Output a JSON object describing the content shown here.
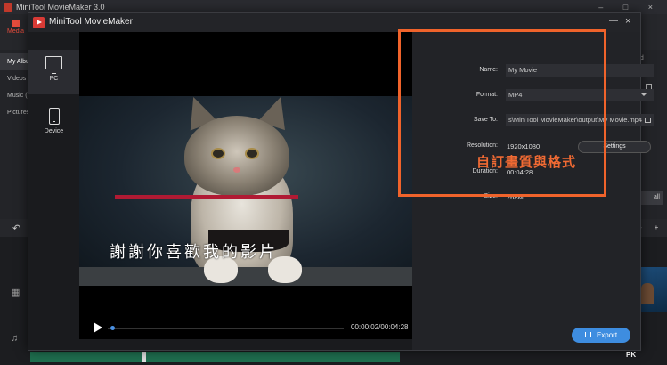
{
  "app": {
    "title": "MiniTool MovieMaker 3.0",
    "window_controls": "–  □  ×",
    "media_tab": "Media",
    "sidebar_items": [
      "My Album",
      "Videos",
      "Music (",
      "Pictures"
    ],
    "right_label": "ed",
    "all_button": "all",
    "undo_icon": "undo-icon",
    "zoom_controls": "–  +"
  },
  "dialog": {
    "title": "MiniTool MovieMaker",
    "minimize": "—",
    "close": "×",
    "devices": [
      {
        "label": "PC",
        "icon": "monitor-icon",
        "selected": true
      },
      {
        "label": "Device",
        "icon": "phone-icon",
        "selected": false
      }
    ],
    "subtitle_text": "謝謝你喜歡我的影片",
    "time": "00:00:02/00:04:28",
    "progress": 0.01,
    "fields": {
      "name_label": "Name:",
      "name_value": "My Movie",
      "format_label": "Format:",
      "format_value": "MP4",
      "save_label": "Save To:",
      "save_value": "s\\MiniTool MovieMaker\\output\\My Movie.mp4",
      "resolution_label": "Resolution:",
      "resolution_value": "1920x1080",
      "settings_button": "Settings",
      "duration_label": "Duration:",
      "duration_value": "00:04:28",
      "size_label": "Size:",
      "size_value": "268M"
    },
    "callout": "自訂畫質與格式",
    "export_button": "Export",
    "accent": "#3e8de0",
    "highlight_color": "#f0632b"
  },
  "watermark": "PK"
}
